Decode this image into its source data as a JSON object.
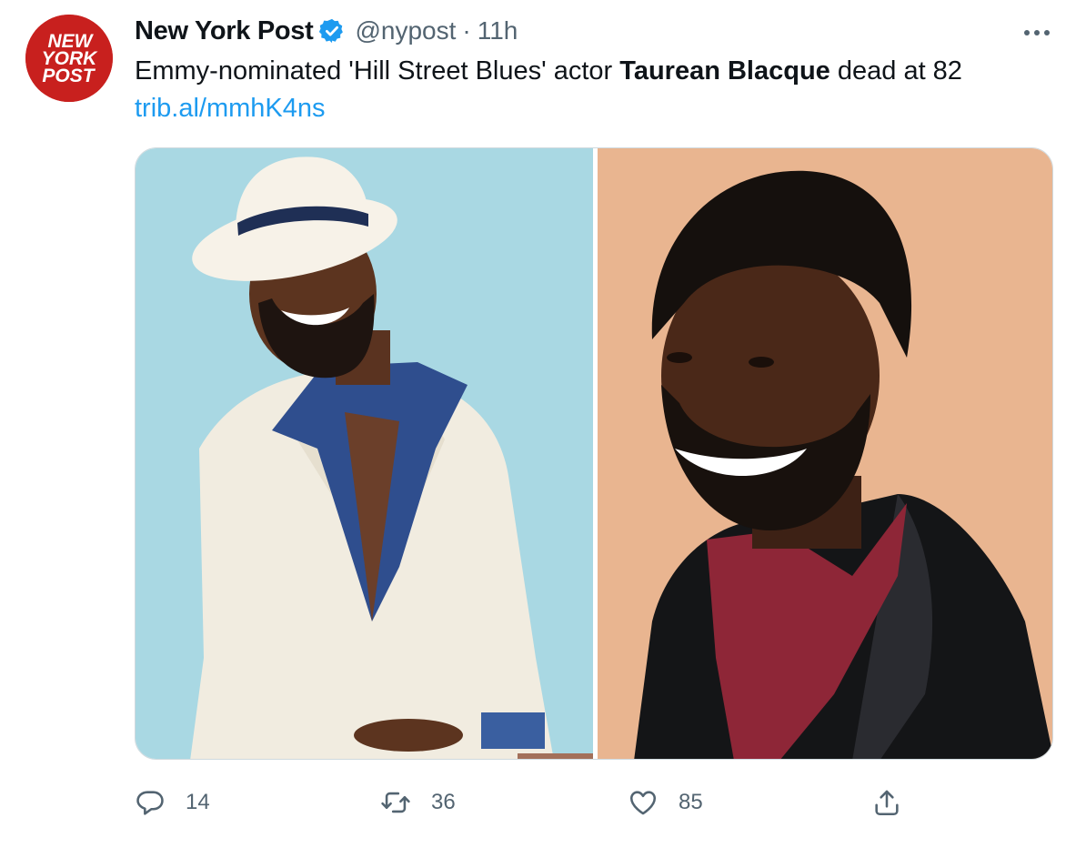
{
  "account": {
    "display_name": "New York Post",
    "handle": "@nypost",
    "separator": "·",
    "timestamp": "11h",
    "verified_icon": "verified-badge-icon",
    "avatar_text": [
      "NEW",
      "YORK",
      "POST"
    ]
  },
  "tweet": {
    "text_before": "Emmy-nominated 'Hill Street Blues' actor ",
    "text_bold": "Taurean Blacque",
    "text_after": " dead at 82",
    "link": "trib.al/mmhK4ns"
  },
  "media": {
    "images": [
      {
        "name": "photo-left",
        "description_icon": "photo"
      },
      {
        "name": "photo-right",
        "description_icon": "photo"
      }
    ]
  },
  "actions": {
    "reply": {
      "icon": "reply-icon",
      "count": "14"
    },
    "retweet": {
      "icon": "retweet-icon",
      "count": "36"
    },
    "like": {
      "icon": "heart-icon",
      "count": "85"
    },
    "share": {
      "icon": "share-icon"
    }
  },
  "colors": {
    "accent": "#1d9bf0",
    "secondary_text": "#536471",
    "brand_red": "#c8201e"
  }
}
